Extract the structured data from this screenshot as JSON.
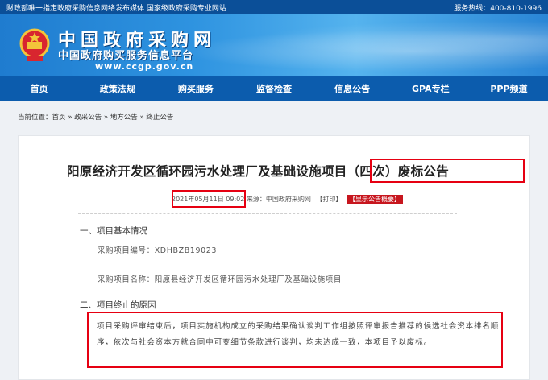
{
  "topbar": {
    "left_text": "财政部唯一指定政府采购信息网络发布媒体 国家级政府采购专业网站",
    "hotline": "服务热线：400-810-1996"
  },
  "header": {
    "logo_cn": "中国政府采购网",
    "logo_sub": "中国政府购买服务信息平台",
    "logo_url": "www.ccgp.gov.cn"
  },
  "nav": {
    "items": [
      "首页",
      "政策法规",
      "购买服务",
      "监督检查",
      "信息公告",
      "GPA专栏",
      "PPP频道"
    ]
  },
  "breadcrumb": {
    "label": "当前位置：",
    "items": [
      "首页",
      "政采公告",
      "地方公告",
      "终止公告"
    ]
  },
  "article": {
    "title": "阳原经济开发区循环园污水处理厂及基础设施项目（四次）废标公告",
    "date": "2021年05月11日",
    "time": "09:02",
    "source": "来源：中国政府采购网",
    "print": "【打印】",
    "show_summary": "【显示公告概要】",
    "section1_heading": "一、项目基本情况",
    "project_no": "采购项目编号：XDHBZB19023",
    "project_name": "采购项目名称：阳原县经济开发区循环园污水处理厂及基础设施项目",
    "section2_heading": "二、项目终止的原因",
    "reason_text": "项目采购评审结束后，项目实施机构成立的采购结果确认谈判工作组按照评审报告推荐的候选社会资本排名顺序，依次与社会资本方就合同中可变细节条款进行谈判，均未达成一致，本项目予以废标。"
  },
  "colors": {
    "nav_bg": "#0c5cad",
    "topbar_bg": "#0b4f98",
    "highlight": "#e60012",
    "badge": "#c7161e"
  }
}
